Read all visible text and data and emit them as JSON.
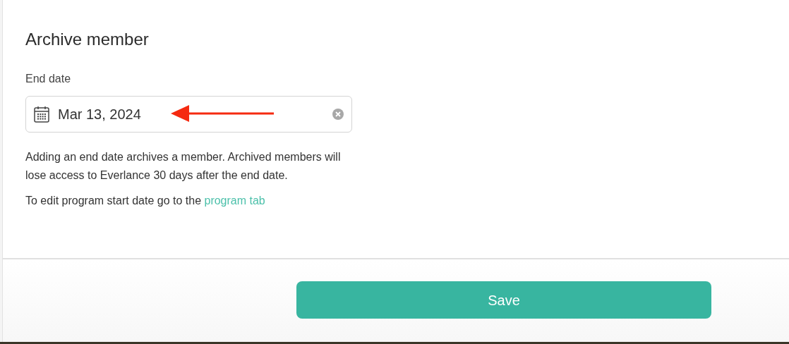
{
  "dialog": {
    "title": "Archive member"
  },
  "end_date": {
    "label": "End date",
    "value": "Mar 13, 2024"
  },
  "help_text": "Adding an end date archives a member. Archived members will lose access to Everlance 30 days after the end date.",
  "program_note": {
    "text": "To edit program start date go to the",
    "link": "program tab"
  },
  "save_button": {
    "label": "Save"
  }
}
